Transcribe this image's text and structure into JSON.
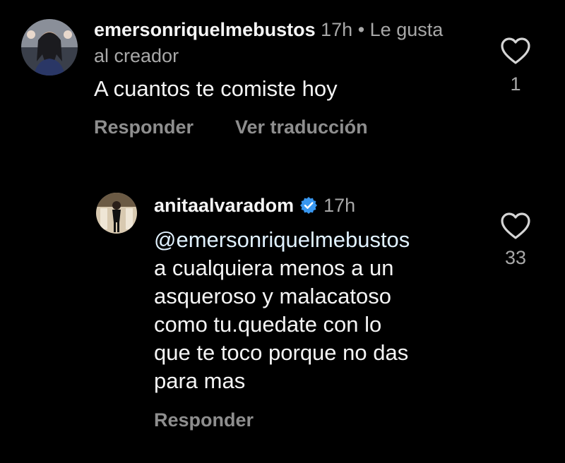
{
  "comments": [
    {
      "username": "emersonriquelmebustos",
      "time": "17h",
      "separator": "•",
      "creator_like": "Le gusta al creador",
      "text": "A cuantos te comiste hoy",
      "like_count": "1",
      "actions": {
        "reply": "Responder",
        "translate": "Ver traducción"
      }
    }
  ],
  "reply": {
    "username": "anitaalvaradom",
    "verified": true,
    "time": "17h",
    "mention": "@emersonriquelmebustos",
    "text_lines": [
      "a cualquiera menos a un",
      "asqueroso y malacatoso",
      "como tu.quedate con lo",
      "que te toco porque no das",
      "para mas"
    ],
    "like_count": "33",
    "actions": {
      "reply": "Responder"
    }
  },
  "colors": {
    "background": "#000000",
    "primary_text": "#f5f5f5",
    "secondary_text": "#a8a8a8",
    "verified_badge": "#3897f0"
  },
  "icons": [
    "heart-outline-icon",
    "verified-badge-icon"
  ]
}
